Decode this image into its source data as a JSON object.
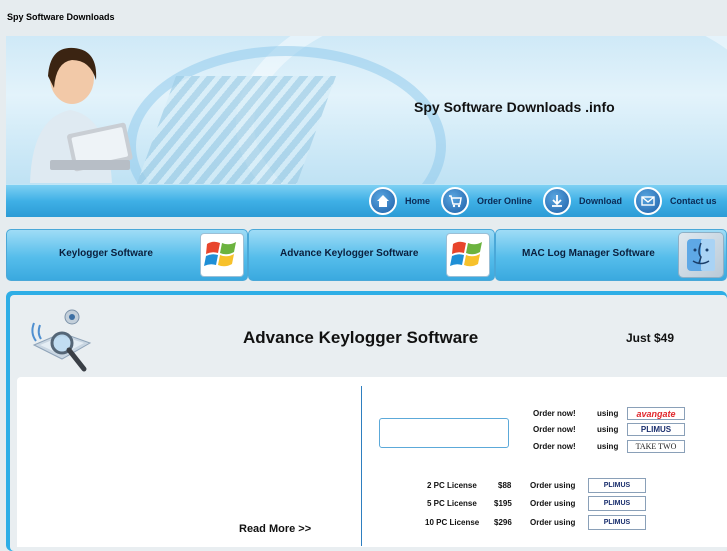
{
  "page": {
    "title": "Spy Software Downloads"
  },
  "banner": {
    "site_name": "Spy Software Downloads .info"
  },
  "nav": {
    "items": [
      {
        "label": "Home",
        "icon": "home-icon"
      },
      {
        "label": "Order Online",
        "icon": "cart-icon"
      },
      {
        "label": "Download",
        "icon": "download-icon"
      },
      {
        "label": "Contact us",
        "icon": "mail-icon"
      }
    ]
  },
  "tabs": [
    {
      "label": "Keylogger Software",
      "icon": "windows-logo-icon"
    },
    {
      "label": "Advance Keylogger Software",
      "icon": "windows-logo-icon"
    },
    {
      "label": "MAC Log Manager Software",
      "icon": "mac-finder-icon"
    }
  ],
  "product": {
    "title": "Advance Keylogger Software",
    "price": "Just $49",
    "read_more": "Read More >>"
  },
  "order": {
    "rows": [
      {
        "label": "Order now!",
        "using": "using",
        "vendor": "avangate"
      },
      {
        "label": "Order now!",
        "using": "using",
        "vendor": "PLIMUS"
      },
      {
        "label": "Order now!",
        "using": "using",
        "vendor": "TAKE TWO"
      }
    ]
  },
  "licenses": [
    {
      "name": "2 PC License",
      "price": "$88",
      "action": "Order using",
      "vendor": "PLIMUS"
    },
    {
      "name": "5 PC License",
      "price": "$195",
      "action": "Order using",
      "vendor": "PLIMUS"
    },
    {
      "name": "10 PC License",
      "price": "$296",
      "action": "Order using",
      "vendor": "PLIMUS"
    }
  ],
  "colors": {
    "accent": "#2eaee6",
    "nav_text": "#0b2a55",
    "avangate": "#e0262b",
    "plimus": "#1a2f6e"
  }
}
